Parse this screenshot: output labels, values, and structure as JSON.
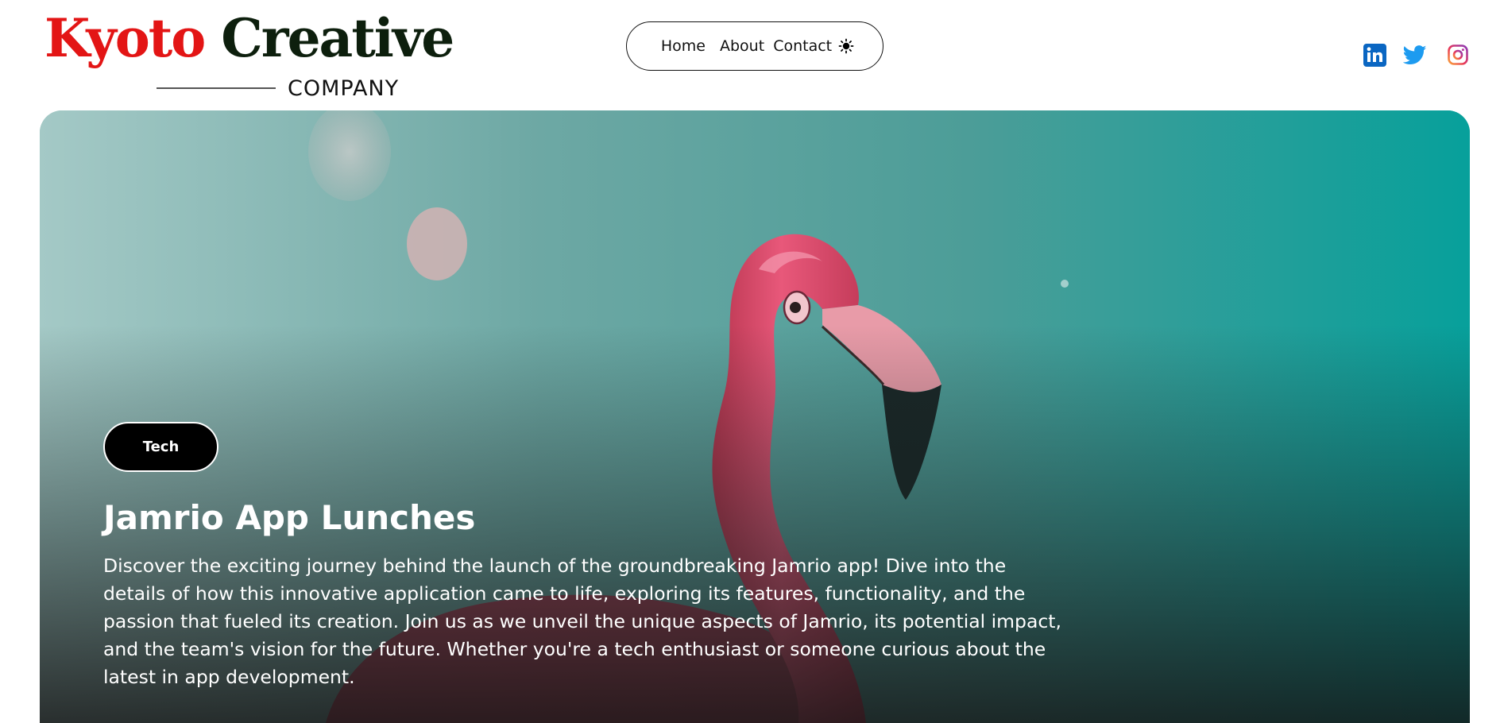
{
  "logo": {
    "word_a": "Kyoto",
    "word_b": "Creative",
    "subline": "COMPANY"
  },
  "nav": {
    "items": [
      {
        "label": "Home"
      },
      {
        "label": "About"
      },
      {
        "label": "Contact"
      }
    ],
    "theme_icon": "sun-icon"
  },
  "social": {
    "icons": [
      "linkedin-icon",
      "twitter-icon",
      "instagram-icon"
    ]
  },
  "hero": {
    "tag": "Tech",
    "title": "Jamrio App Lunches",
    "description": "Discover the exciting journey behind the launch of the groundbreaking Jamrio app! Dive into the details of how this innovative application came to life, exploring its features, functionality, and the passion that fueled its creation. Join us as we unveil the unique aspects of Jamrio, its potential impact, and the team's vision for the future. Whether you're a tech enthusiast or someone curious about the latest in app development."
  },
  "colors": {
    "logo_red": "#e31515",
    "logo_dark": "#0d1f0d",
    "linkedin": "#0a66c2",
    "twitter": "#1d9bf0",
    "hero_teal": "#0d9e99",
    "flamingo_pink": "#e2506e"
  }
}
